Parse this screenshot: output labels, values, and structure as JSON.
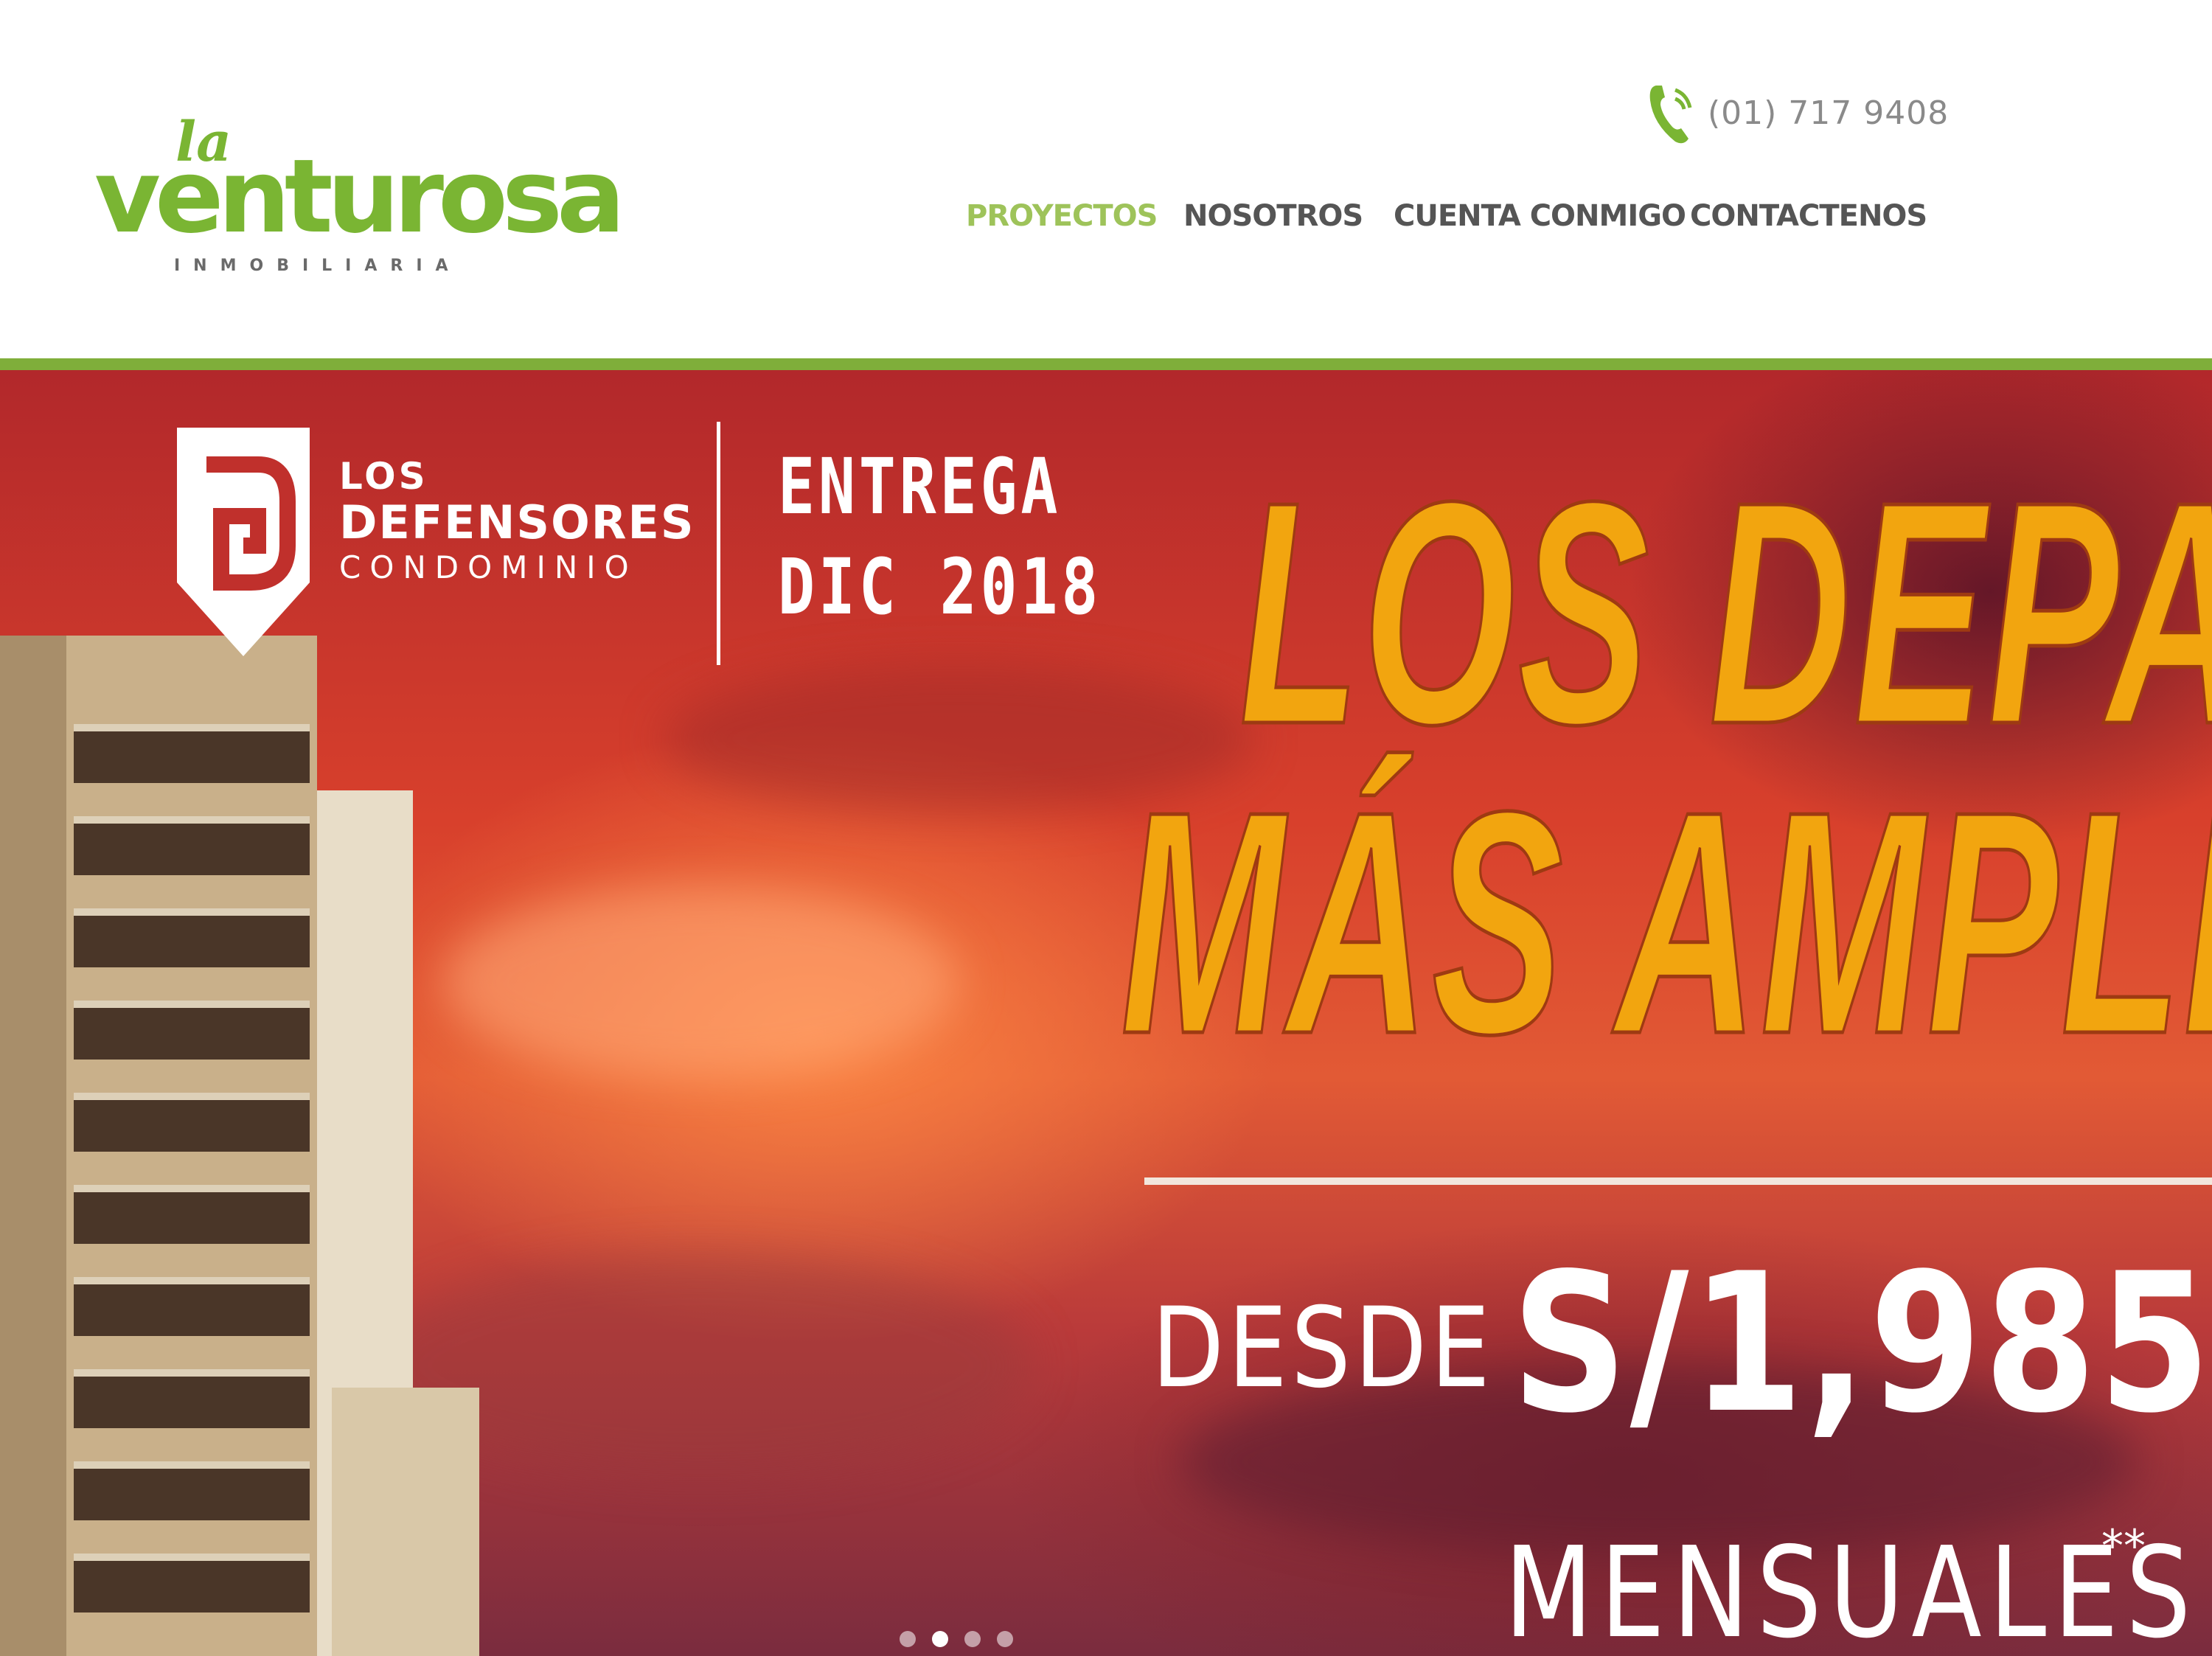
{
  "header": {
    "logo": {
      "prefix": "la",
      "name": "venturosa",
      "tagline": "INMOBILIARIA"
    },
    "phone": {
      "icon": "phone-icon",
      "number": "(01) 717 9408"
    },
    "nav": [
      {
        "label": "PROYECTOS",
        "active": true
      },
      {
        "label": "NOSOTROS",
        "active": false
      },
      {
        "label": "CUENTA CONMIGO",
        "active": false
      },
      {
        "label": "CONTACTENOS",
        "active": false
      }
    ],
    "accent_color": "#7fae3a"
  },
  "hero": {
    "project": {
      "line1": "LOS",
      "line2": "DEFENSORES",
      "line3": "CONDOMINIO"
    },
    "delivery": {
      "line1": "ENTREGA",
      "line2": "DIC 2018"
    },
    "headline": {
      "line1": "LOS DEPAS",
      "line2": "MÁS AMPLIOS"
    },
    "price_prefix": "DESDE",
    "price": "S/1,985",
    "price_suffix": "MENSUALES",
    "footnote_mark": "**",
    "slides": 4,
    "active_slide": 2,
    "headline_color": "#f2a50f"
  }
}
